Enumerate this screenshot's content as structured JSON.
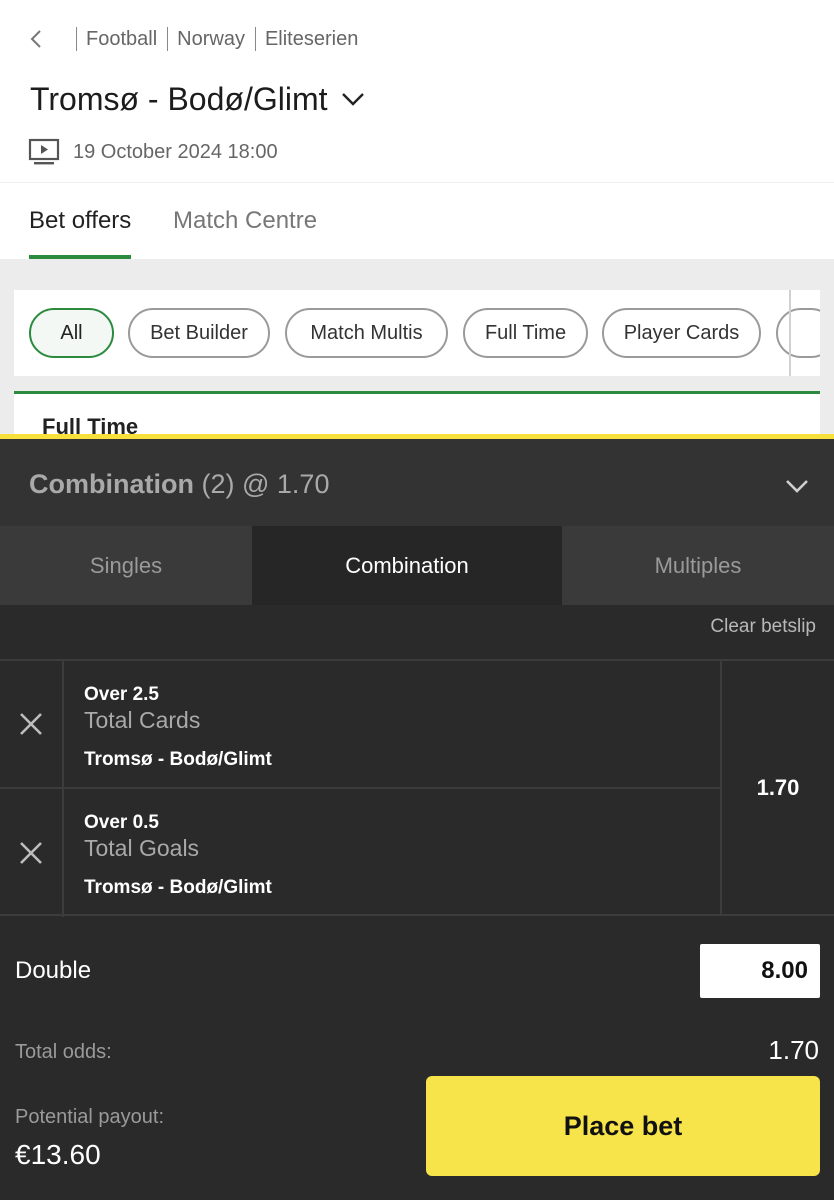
{
  "breadcrumb": {
    "items": [
      "Football",
      "Norway",
      "Eliteserien"
    ]
  },
  "match": {
    "title": "Tromsø - Bodø/Glimt",
    "datetime": "19 October 2024 18:00"
  },
  "page_tabs": [
    {
      "label": "Bet offers",
      "active": true
    },
    {
      "label": "Match Centre",
      "active": false
    }
  ],
  "filters": [
    {
      "label": "All",
      "active": true
    },
    {
      "label": "Bet Builder",
      "active": false
    },
    {
      "label": "Match Multis",
      "active": false
    },
    {
      "label": "Full Time",
      "active": false
    },
    {
      "label": "Player Cards",
      "active": false
    }
  ],
  "section_title": "Full Time",
  "betslip": {
    "title_bold": "Combination",
    "title_rest": "(2) @ 1.70",
    "tabs": [
      {
        "label": "Singles",
        "active": false
      },
      {
        "label": "Combination",
        "active": true
      },
      {
        "label": "Multiples",
        "active": false
      }
    ],
    "clear_label": "Clear betslip",
    "selections": [
      {
        "pick": "Over 2.5",
        "market": "Total Cards",
        "event": "Tromsø - Bodø/Glimt"
      },
      {
        "pick": "Over 0.5",
        "market": "Total Goals",
        "event": "Tromsø - Bodø/Glimt"
      }
    ],
    "combined_odds": "1.70",
    "bet_type": "Double",
    "stake": "8.00",
    "total_odds_label": "Total odds:",
    "total_odds": "1.70",
    "payout_label": "Potential payout:",
    "payout": "€13.60",
    "place_label": "Place bet"
  },
  "colors": {
    "accent_green": "#2b8a3e",
    "highlight_yellow": "#f7e34a",
    "slip_background": "#2a2a2a"
  }
}
